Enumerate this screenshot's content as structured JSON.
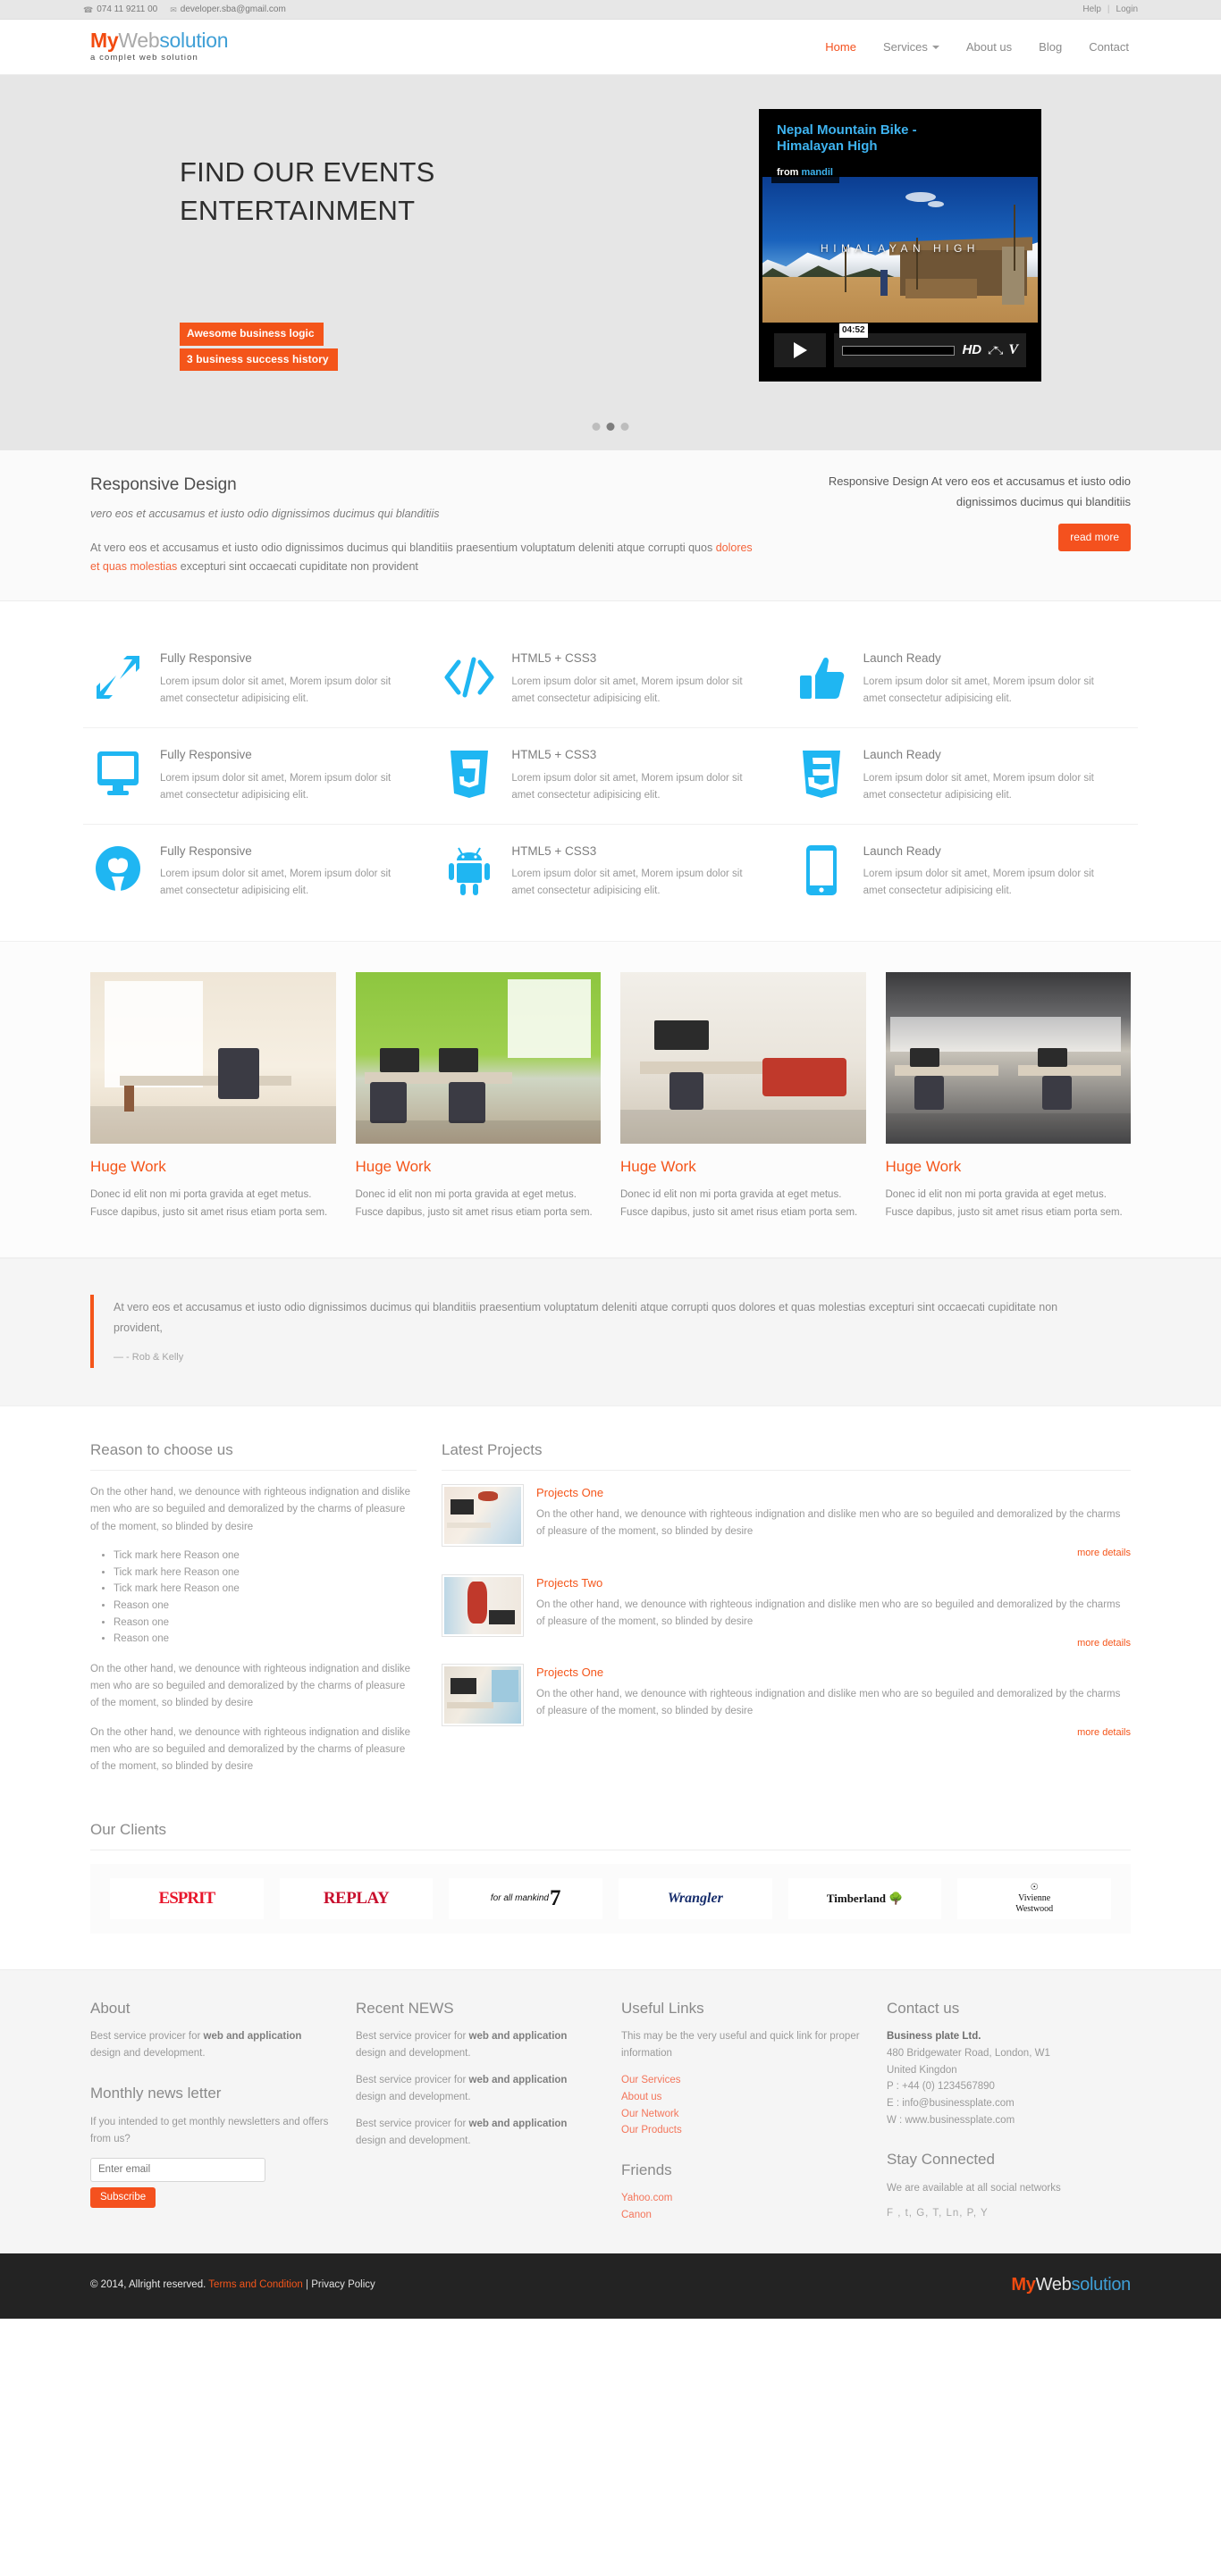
{
  "topbar": {
    "phone": "074 11 9211 00",
    "email": "developer.sba@gmail.com",
    "phone_icon": "phone-icon",
    "email_icon": "envelope-icon",
    "help": "Help",
    "separator": "|",
    "login": "Login"
  },
  "header": {
    "logo": {
      "part1": "My",
      "part2": "Web",
      "part3": "solution",
      "tagline": "a complet web solution"
    },
    "nav": [
      {
        "label": "Home",
        "active": true,
        "caret": false
      },
      {
        "label": "Services",
        "active": false,
        "caret": true
      },
      {
        "label": "About us",
        "active": false,
        "caret": false
      },
      {
        "label": "Blog",
        "active": false,
        "caret": false
      },
      {
        "label": "Contact",
        "active": false,
        "caret": false
      }
    ]
  },
  "hero": {
    "title_line1": "FIND OUR EVENTS",
    "title_line2": "ENTERTAINMENT",
    "badge1": "Awesome business logic",
    "badge2": "3 business success history",
    "slide_count": 3,
    "active_slide": 2,
    "video": {
      "title": "Nepal Mountain Bike - Himalayan High",
      "from_prefix": "from",
      "from_author": "mandil",
      "overlay_text": "HIMALAYAN HIGH",
      "duration": "04:52",
      "hd": "HD",
      "brand": "V"
    }
  },
  "intro": {
    "heading": "Responsive Design",
    "subheading": "vero eos et accusamus et iusto odio dignissimos ducimus qui blanditiis",
    "body_part1": "At vero eos et accusamus et iusto odio dignissimos ducimus qui blanditiis praesentium voluptatum deleniti atque corrupti quos ",
    "body_highlight": "dolores et quas molestias",
    "body_part2": " excepturi sint occaecati cupiditate non provident",
    "right_text": "Responsive Design At vero eos et accusamus et iusto odio dignissimos ducimus qui blanditiis",
    "read_more": "read more"
  },
  "features": {
    "rows": [
      [
        {
          "icon": "resize-arrows-icon",
          "title": "Fully Responsive",
          "desc": "Lorem ipsum dolor sit amet, Morem ipsum dolor sit amet consectetur adipisicing elit."
        },
        {
          "icon": "code-brackets-icon",
          "title": "HTML5 + CSS3",
          "desc": "Lorem ipsum dolor sit amet, Morem ipsum dolor sit amet consectetur adipisicing elit."
        },
        {
          "icon": "thumbs-up-icon",
          "title": "Launch Ready",
          "desc": "Lorem ipsum dolor sit amet, Morem ipsum dolor sit amet consectetur adipisicing elit."
        }
      ],
      [
        {
          "icon": "desktop-monitor-icon",
          "title": "Fully Responsive",
          "desc": "Lorem ipsum dolor sit amet, Morem ipsum dolor sit amet consectetur adipisicing elit."
        },
        {
          "icon": "html5-shield-icon",
          "title": "HTML5 + CSS3",
          "desc": "Lorem ipsum dolor sit amet, Morem ipsum dolor sit amet consectetur adipisicing elit."
        },
        {
          "icon": "css3-shield-icon",
          "title": "Launch Ready",
          "desc": "Lorem ipsum dolor sit amet, Morem ipsum dolor sit amet consectetur adipisicing elit."
        }
      ],
      [
        {
          "icon": "github-octocat-icon",
          "title": "Fully Responsive",
          "desc": "Lorem ipsum dolor sit amet, Morem ipsum dolor sit amet consectetur adipisicing elit."
        },
        {
          "icon": "android-robot-icon",
          "title": "HTML5 + CSS3",
          "desc": "Lorem ipsum dolor sit amet, Morem ipsum dolor sit amet consectetur adipisicing elit."
        },
        {
          "icon": "mobile-phone-icon",
          "title": "Launch Ready",
          "desc": "Lorem ipsum dolor sit amet, Morem ipsum dolor sit amet consectetur adipisicing elit."
        }
      ]
    ]
  },
  "portfolio": [
    {
      "title": "Huge Work",
      "desc": "Donec id elit non mi porta gravida at eget metus. Fusce dapibus, justo sit amet risus etiam porta sem.",
      "scene": "sc-a"
    },
    {
      "title": "Huge Work",
      "desc": "Donec id elit non mi porta gravida at eget metus. Fusce dapibus, justo sit amet risus etiam porta sem.",
      "scene": "sc-b"
    },
    {
      "title": "Huge Work",
      "desc": "Donec id elit non mi porta gravida at eget metus. Fusce dapibus, justo sit amet risus etiam porta sem.",
      "scene": "sc-c"
    },
    {
      "title": "Huge Work",
      "desc": "Donec id elit non mi porta gravida at eget metus. Fusce dapibus, justo sit amet risus etiam porta sem.",
      "scene": "sc-d"
    }
  ],
  "quote": {
    "text": "At vero eos et accusamus et iusto odio dignissimos ducimus qui blanditiis praesentium voluptatum deleniti atque corrupti quos dolores et quas molestias excepturi sint occaecati cupiditate non provident,",
    "cite": "— - Rob & Kelly"
  },
  "reason": {
    "title": "Reason to choose us",
    "para1": "On the other hand, we denounce with righteous indignation and dislike men who are so beguiled and demoralized by the charms of pleasure of the moment, so blinded by desire",
    "list": [
      "Tick mark here Reason one",
      "Tick mark here Reason one",
      "Tick mark here Reason one",
      "Reason one",
      "Reason one",
      "Reason one"
    ],
    "para2": "On the other hand, we denounce with righteous indignation and dislike men who are so beguiled and demoralized by the charms of pleasure of the moment, so blinded by desire",
    "para3": "On the other hand, we denounce with righteous indignation and dislike men who are so beguiled and demoralized by the charms of pleasure of the moment, so blinded by desire"
  },
  "latest_projects": {
    "title": "Latest Projects",
    "more_label": "more details",
    "items": [
      {
        "title": "Projects One",
        "desc": "On the other hand, we denounce with righteous indignation and dislike men who are so beguiled and demoralized by the charms of pleasure of the moment, so blinded by desire",
        "thumb": "pr-a"
      },
      {
        "title": "Projects Two",
        "desc": "On the other hand, we denounce with righteous indignation and dislike men who are so beguiled and demoralized by the charms of pleasure of the moment, so blinded by desire",
        "thumb": "pr-b"
      },
      {
        "title": "Projects One",
        "desc": "On the other hand, we denounce with righteous indignation and dislike men who are so beguiled and demoralized by the charms of pleasure of the moment, so blinded by desire",
        "thumb": "pr-c"
      }
    ]
  },
  "clients": {
    "title": "Our Clients",
    "logos": [
      "ESPRIT",
      "REPLAY",
      "for all mankind",
      "Wrangler",
      "Timberland",
      "Vivienne Westwood"
    ],
    "seven_mark": "7",
    "vw_line1": "Vivienne",
    "vw_line2": "Westwood",
    "timber_mark": "Timberland",
    "timber_tree": "tree-icon"
  },
  "footer": {
    "about": {
      "title": "About",
      "text_a": "Best service provicer for ",
      "text_b": "web and application",
      "text_c": " design and development."
    },
    "newsletter": {
      "title": "Monthly news letter",
      "text": "If you intended to get monthly newsletters and offers from us?",
      "placeholder": "Enter email",
      "value": "",
      "button": "Subscribe"
    },
    "recent_news": {
      "title": "Recent NEWS",
      "items": [
        {
          "a": "Best service provicer for ",
          "b": "web and application",
          "c": " design and development."
        },
        {
          "a": "Best service provicer for ",
          "b": "web and application",
          "c": " design and development."
        },
        {
          "a": "Best service provicer for ",
          "b": "web and application",
          "c": " design and development."
        }
      ]
    },
    "useful": {
      "title": "Useful Links",
      "text": "This may be the very useful and quick link for proper information",
      "links": [
        "Our Services",
        "About us",
        "Our Network",
        "Our Products"
      ]
    },
    "friends": {
      "title": "Friends",
      "links": [
        "Yahoo.com",
        "Canon"
      ]
    },
    "contact": {
      "title": "Contact us",
      "company": "Business plate Ltd.",
      "line1": "480 Bridgewater Road, London, W1",
      "line2": "United Kingdon",
      "line3": "P : +44 (0) 1234567890",
      "line4": "E : info@businessplate.com",
      "line5": "W : www.businessplate.com"
    },
    "stay": {
      "title": "Stay Connected",
      "text": "We are available at all social networks",
      "social": "F , t, G, T, Ln, P, Y"
    }
  },
  "copyright": {
    "text": "© 2014, Allright reserved.",
    "terms": "Terms and Condition",
    "separator": "|",
    "privacy": "Privacy Policy",
    "logo": {
      "part1": "My",
      "part2": "Web",
      "part3": "solution"
    }
  },
  "colors": {
    "accent_orange": "#f4511e",
    "logo_blue": "#3f9fd6",
    "icon_blue": "#1fb6f2",
    "dark_footer": "#232323"
  }
}
